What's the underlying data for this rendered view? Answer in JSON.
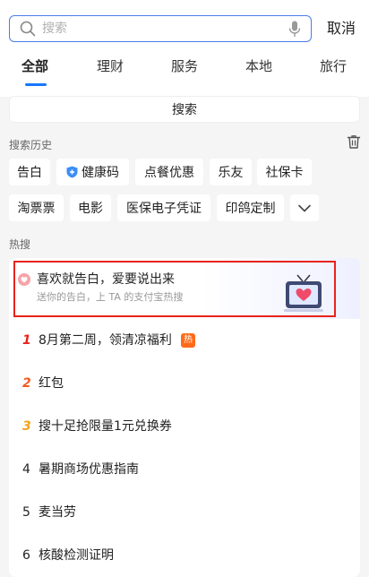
{
  "search": {
    "placeholder": "搜索",
    "cancel_label": "取消"
  },
  "tabs": [
    {
      "label": "全部",
      "active": true
    },
    {
      "label": "理财"
    },
    {
      "label": "服务"
    },
    {
      "label": "本地"
    },
    {
      "label": "旅行"
    }
  ],
  "search_button_label": "搜索",
  "history": {
    "label": "搜索历史",
    "items": [
      "告白",
      "健康码",
      "点餐优惠",
      "乐友",
      "社保卡",
      "淘票票",
      "电影",
      "医保电子凭证",
      "印鸽定制"
    ]
  },
  "hot": {
    "label": "热搜",
    "featured": {
      "title": "喜欢就告白，爱要说出来",
      "subtitle": "送你的告白，上 TA 的支付宝热搜"
    },
    "items": [
      {
        "rank": "1",
        "text": "8月第二周，领清凉福利",
        "badge": "热"
      },
      {
        "rank": "2",
        "text": "红包"
      },
      {
        "rank": "3",
        "text": "搜十足抢限量1元兑换券"
      },
      {
        "rank": "4",
        "text": "暑期商场优惠指南"
      },
      {
        "rank": "5",
        "text": "麦当劳"
      },
      {
        "rank": "6",
        "text": "核酸检测证明"
      }
    ]
  },
  "colors": {
    "accent": "#1677ff",
    "rank_1": "#e8231b",
    "rank_2": "#f05a22",
    "rank_3": "#f2a31a",
    "rank_other": "#222222",
    "highlight_border": "#e8231b",
    "hot_badge": "#ff6a1a"
  },
  "icons": [
    "search-icon",
    "microphone-icon",
    "trash-icon",
    "shield-plus-icon",
    "chevron-down-icon",
    "heart-icon",
    "tv-heart-icon"
  ]
}
